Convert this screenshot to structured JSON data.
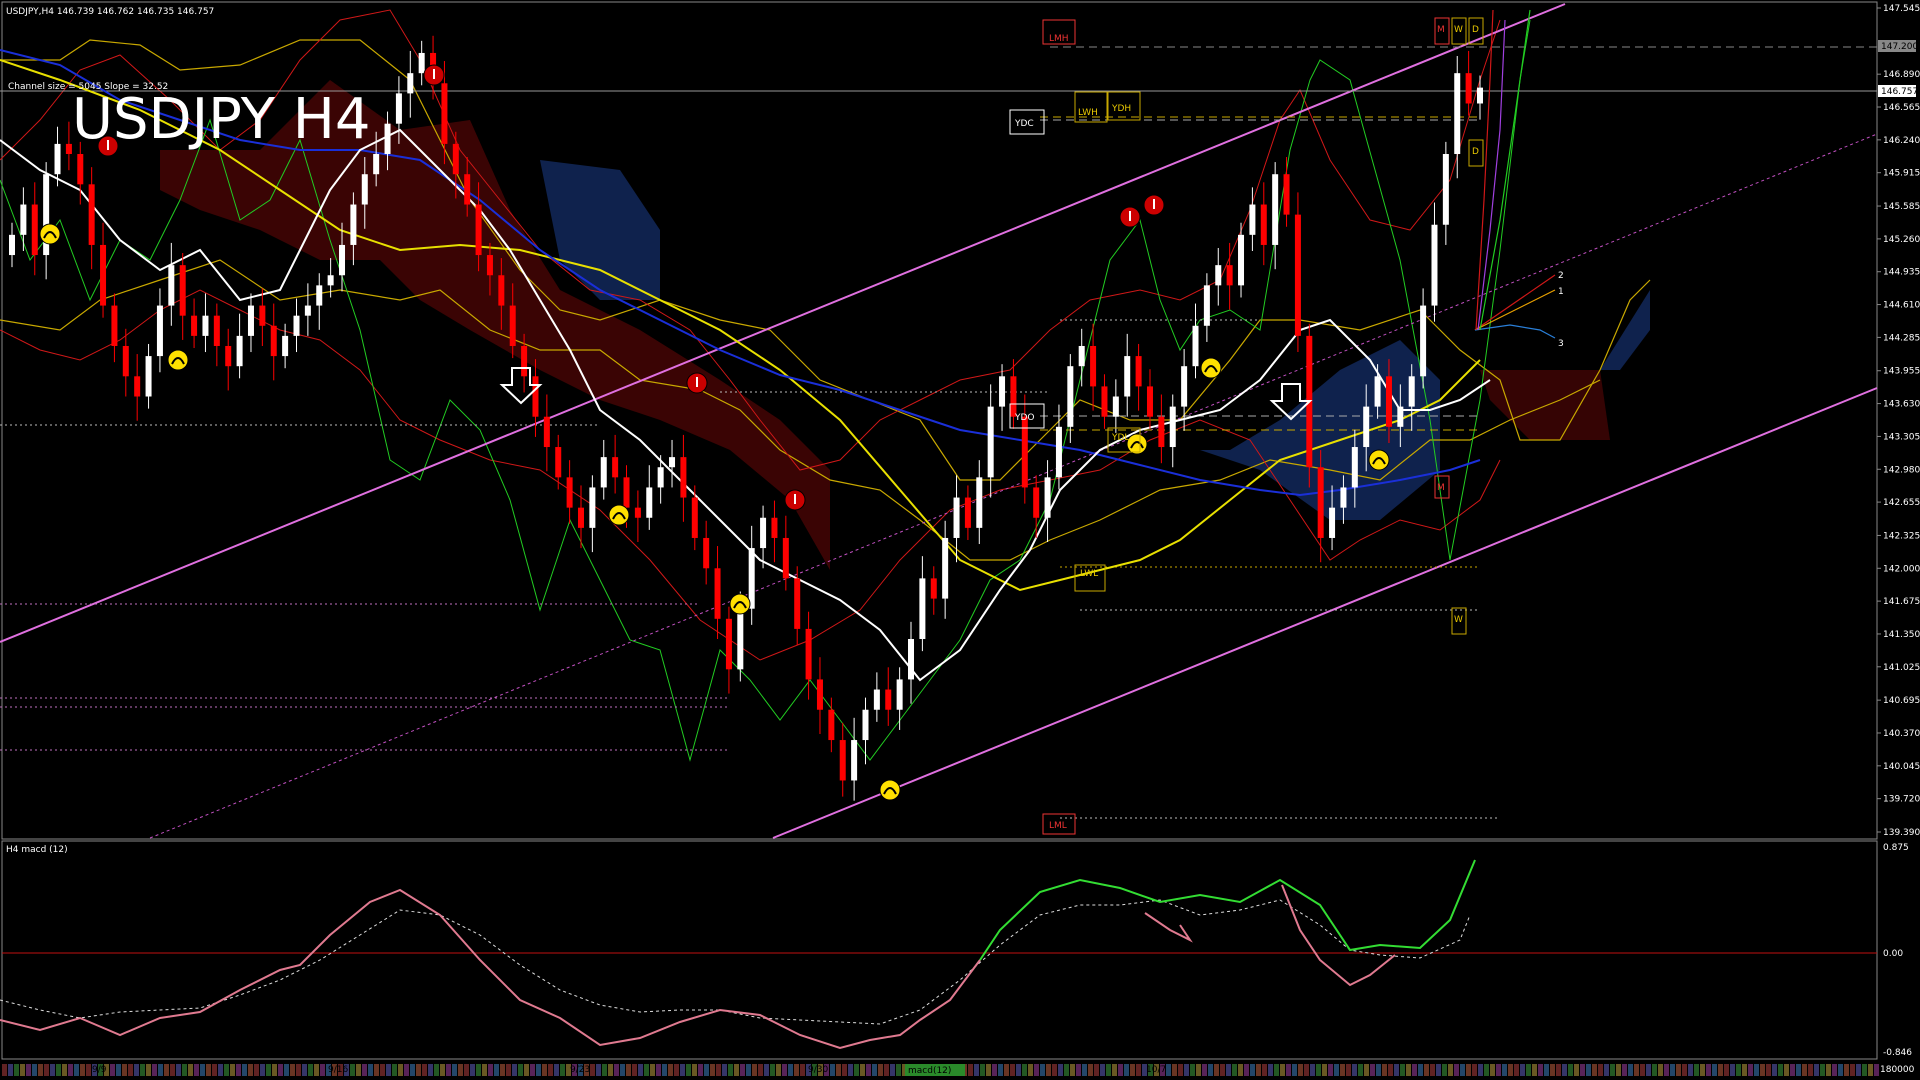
{
  "header": {
    "symbol_info": "USDJPY,H4  146.739 146.762 146.735 146.757",
    "channel_info": "Channel size = 5045 Slope = 32.52",
    "big_title": "USDJPY H4"
  },
  "price_axis": {
    "ticks": [
      "147.545",
      "147.200",
      "146.890",
      "146.757",
      "146.565",
      "146.240",
      "145.915",
      "145.585",
      "145.260",
      "144.935",
      "144.610",
      "144.285",
      "143.955",
      "143.630",
      "143.305",
      "142.980",
      "142.655",
      "142.325",
      "142.000",
      "141.675",
      "141.350",
      "141.025",
      "140.695",
      "140.370",
      "140.045",
      "139.720",
      "139.390"
    ],
    "current_price": "146.757",
    "lmh_price": "147.200"
  },
  "macd_panel": {
    "label": "H4  macd (12)",
    "ticks": [
      "0.875",
      "0.00",
      "-0.846"
    ],
    "bottom_label": "180000"
  },
  "time_axis": {
    "labels": [
      "9/9",
      "9/16",
      "9/23",
      "9/30",
      "10/7"
    ],
    "highlight_label": "macd(12)"
  },
  "level_labels": {
    "lmh": "LMH",
    "lml": "LML",
    "lwh": "LWH",
    "lwl": "LWL",
    "ydh": "YDH",
    "ydl": "YDL",
    "ydc": "YDC",
    "ydo": "YDO",
    "m1": "M",
    "w1": "W",
    "d1": "D",
    "d2": "D",
    "m2": "M",
    "w2": "W"
  },
  "fan_labels": [
    "2",
    "1",
    "3"
  ],
  "colors": {
    "bull": "#ffffff",
    "bear": "#ff0000",
    "magenta": "#e070e0",
    "yellow": "#e8e000",
    "blue": "#1a2fd8",
    "green": "#22cc22",
    "cloud_red": "#a01010",
    "cloud_blue": "#1a3aa0",
    "kumo_line": "#c8a800"
  },
  "chart_data": {
    "type": "candlestick",
    "title": "USDJPY H4",
    "ylim": [
      139.39,
      147.545
    ],
    "x_labels": [
      "9/9",
      "9/16",
      "9/23",
      "9/30",
      "10/7"
    ],
    "key_levels": {
      "LMH": 147.2,
      "LML": 139.58,
      "LWH": 146.47,
      "LWL": 142.05,
      "YDH": 146.55,
      "YDL": 143.3
    },
    "last_close": 146.757,
    "close": [
      145.3,
      145.6,
      145.1,
      145.9,
      146.2,
      146.1,
      145.8,
      145.2,
      144.6,
      144.2,
      143.9,
      143.7,
      144.1,
      144.6,
      145.0,
      144.5,
      144.3,
      144.5,
      144.2,
      144.0,
      144.3,
      144.6,
      144.4,
      144.1,
      144.3,
      144.5,
      144.6,
      144.8,
      144.9,
      145.2,
      145.6,
      145.9,
      146.1,
      146.4,
      146.7,
      146.9,
      147.1,
      146.8,
      146.2,
      145.9,
      145.6,
      145.1,
      144.9,
      144.6,
      144.2,
      143.9,
      143.5,
      143.2,
      142.9,
      142.6,
      142.4,
      142.8,
      143.1,
      142.9,
      142.6,
      142.5,
      142.8,
      143.0,
      143.1,
      142.7,
      142.3,
      142.0,
      141.5,
      141.0,
      141.6,
      142.2,
      142.5,
      142.3,
      141.9,
      141.4,
      140.9,
      140.6,
      140.3,
      139.9,
      140.3,
      140.6,
      140.8,
      140.6,
      140.9,
      141.3,
      141.9,
      141.7,
      142.3,
      142.7,
      142.4,
      142.9,
      143.6,
      143.9,
      143.5,
      142.8,
      142.5,
      142.9,
      143.4,
      144.0,
      144.2,
      143.8,
      143.5,
      143.7,
      144.1,
      143.8,
      143.5,
      143.2,
      143.6,
      144.0,
      144.4,
      144.8,
      145.0,
      144.8,
      145.3,
      145.6,
      145.2,
      145.9,
      145.5,
      144.3,
      143.0,
      142.3,
      142.6,
      142.8,
      143.2,
      143.6,
      143.9,
      143.4,
      143.6,
      143.9,
      144.6,
      145.4,
      146.1,
      146.9,
      146.6,
      146.757
    ]
  }
}
